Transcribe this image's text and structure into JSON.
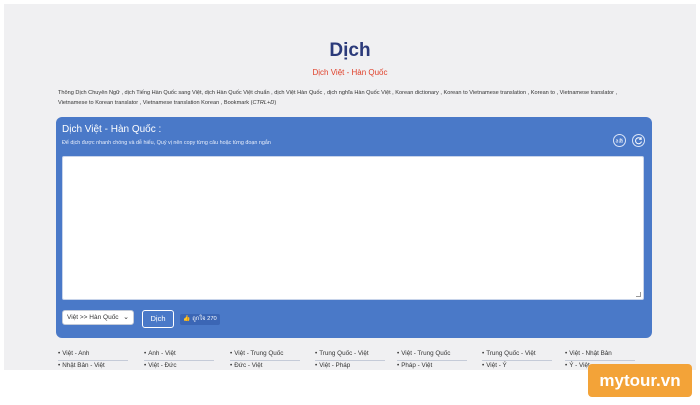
{
  "header": {
    "title": "Dịch",
    "subtitle": "Dịch Việt - Hàn Quốc",
    "description": "Thông Dịch Chuyên Ngữ , dịch Tiếng Hàn Quốc sang Việt, dịch Hàn Quốc Việt chuẩn , dịch Việt Hàn Quốc , dịch nghĩa Hàn Quốc Việt , Korean dictionary , Korean to Vietnamese translation , Korean to , Vietnamese translator , Vietnamese to Korean translator , Vietnamese translation Korean , Bookmark (",
    "shortcut": "CTRL+D",
    "description_end": ")"
  },
  "translator": {
    "title": "Dịch Việt - Hàn Quốc :",
    "hint": "Để dịch được nhanh chóng và dễ hiểu, Quý vị nên copy từng câu hoặc từng đoạn ngắn",
    "input_value": "",
    "direction_select": "Việt >> Hàn Quốc",
    "translate_button": "Dịch",
    "like_label": "ถูกใจ",
    "like_count": "270",
    "icons": [
      "translate-icon",
      "refresh-icon"
    ]
  },
  "language_links": [
    [
      "Việt - Anh",
      "Anh - Việt",
      "Việt - Trung Quốc",
      "Trung Quốc - Việt",
      "Việt - Trung Quốc",
      "Trung Quốc - Việt",
      "Việt - Nhật Bản"
    ],
    [
      "Nhật Bản - Việt",
      "Việt - Đức",
      "Đức - Việt",
      "Việt - Pháp",
      "Pháp - Việt",
      "Việt - Ý",
      "Ý - Việt"
    ]
  ],
  "watermark": "mytour.vn",
  "colors": {
    "panel": "#4a79c8",
    "title": "#2b3a7a",
    "subtitle": "#e0402a",
    "logo": "#f3a338"
  }
}
